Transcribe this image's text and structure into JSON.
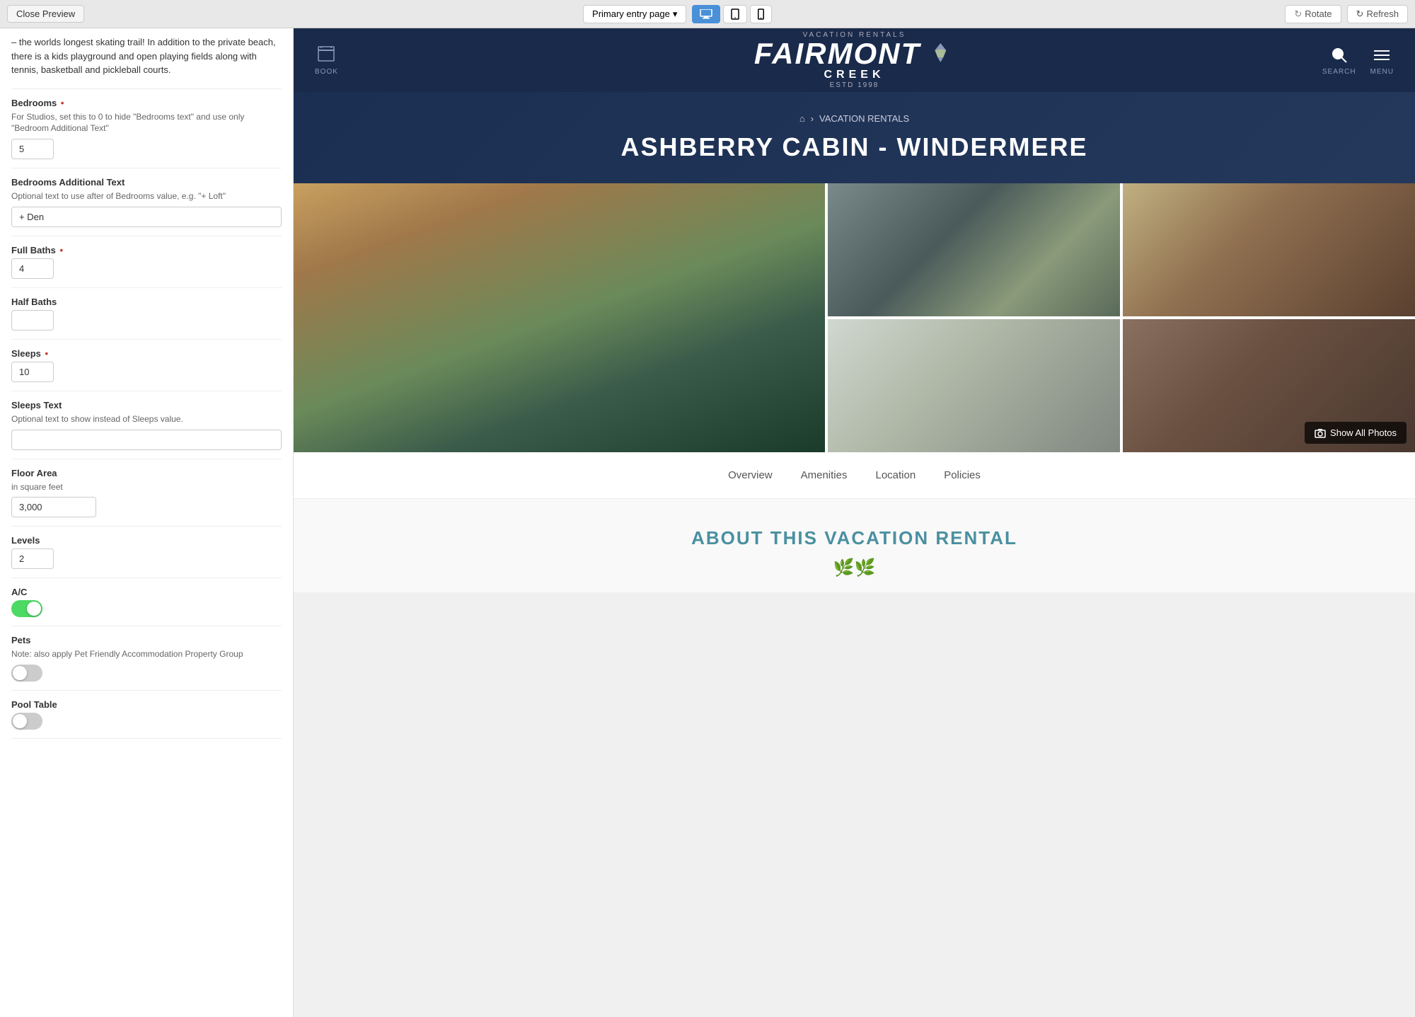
{
  "topbar": {
    "close_preview_label": "Close Preview",
    "entry_page_label": "Primary entry page",
    "entry_page_chevron": "▾",
    "device_desktop_icon": "🖥",
    "device_tablet_icon": "⬜",
    "device_mobile_icon": "📱",
    "rotate_label": "Rotate",
    "rotate_icon": "↻",
    "refresh_label": "Refresh",
    "refresh_icon": "↻"
  },
  "left_panel": {
    "description": "– the worlds longest skating trail! In addition to the private beach, there is a kids playground and open playing fields along with tennis, basketball and pickleball courts.",
    "bedrooms": {
      "label": "Bedrooms",
      "required": true,
      "description": "For Studios, set this to 0 to hide \"Bedrooms text\" and use only \"Bedroom Additional Text\"",
      "value": "5"
    },
    "bedrooms_additional": {
      "label": "Bedrooms Additional Text",
      "description": "Optional text to use after of Bedrooms value, e.g. \"+ Loft\"",
      "value": "+ Den"
    },
    "full_baths": {
      "label": "Full Baths",
      "required": true,
      "value": "4"
    },
    "half_baths": {
      "label": "Half Baths",
      "value": ""
    },
    "sleeps": {
      "label": "Sleeps",
      "required": true,
      "value": "10"
    },
    "sleeps_text": {
      "label": "Sleeps Text",
      "description": "Optional text to show instead of Sleeps value.",
      "value": ""
    },
    "floor_area": {
      "label": "Floor Area",
      "description": "in square feet",
      "value": "3,000"
    },
    "levels": {
      "label": "Levels",
      "value": "2"
    },
    "ac": {
      "label": "A/C",
      "enabled": true
    },
    "pets": {
      "label": "Pets",
      "description": "Note: also apply Pet Friendly Accommodation Property Group",
      "enabled": false
    },
    "pool_table": {
      "label": "Pool Table",
      "enabled": false
    }
  },
  "preview": {
    "nav": {
      "book_label": "BOOK",
      "logo_vacation": "VACATION   RENTALS",
      "logo_fairmont": "FAIRMONT",
      "logo_creek": "CREEK",
      "logo_est": "ESTD   1998",
      "search_label": "SEARCH",
      "menu_label": "MENU"
    },
    "hero": {
      "breadcrumb_home": "⌂",
      "breadcrumb_sep": "›",
      "breadcrumb_section": "VACATION RENTALS",
      "title": "ASHBERRY CABIN - WINDERMERE"
    },
    "photo_grid": {
      "show_all_label": "Show All Photos"
    },
    "tabs": {
      "items": [
        "Overview",
        "Amenities",
        "Location",
        "Policies"
      ]
    },
    "about": {
      "title": "ABOUT THIS VACATION RENTAL",
      "icon": "🌿🌿"
    }
  }
}
